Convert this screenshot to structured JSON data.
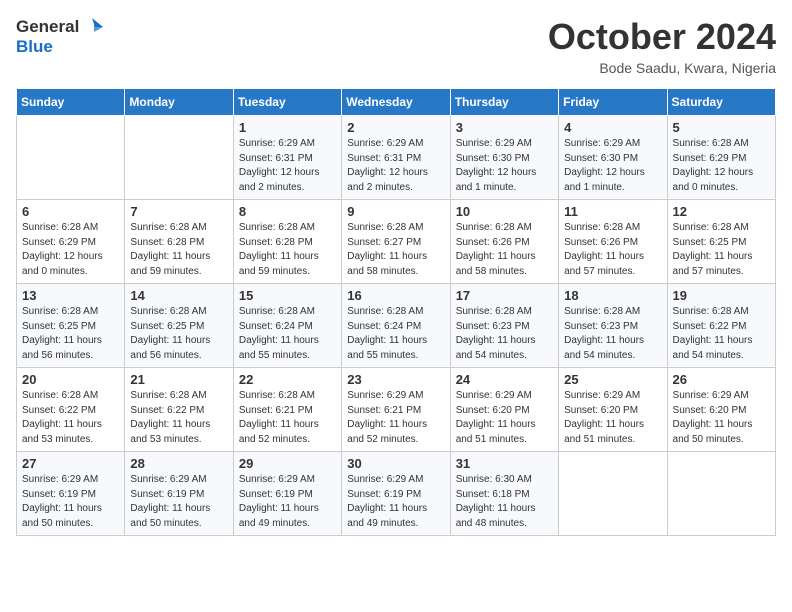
{
  "logo": {
    "general": "General",
    "blue": "Blue"
  },
  "title": "October 2024",
  "location": "Bode Saadu, Kwara, Nigeria",
  "weekdays": [
    "Sunday",
    "Monday",
    "Tuesday",
    "Wednesday",
    "Thursday",
    "Friday",
    "Saturday"
  ],
  "weeks": [
    [
      {
        "day": "",
        "info": ""
      },
      {
        "day": "",
        "info": ""
      },
      {
        "day": "1",
        "info": "Sunrise: 6:29 AM\nSunset: 6:31 PM\nDaylight: 12 hours and 2 minutes."
      },
      {
        "day": "2",
        "info": "Sunrise: 6:29 AM\nSunset: 6:31 PM\nDaylight: 12 hours and 2 minutes."
      },
      {
        "day": "3",
        "info": "Sunrise: 6:29 AM\nSunset: 6:30 PM\nDaylight: 12 hours and 1 minute."
      },
      {
        "day": "4",
        "info": "Sunrise: 6:29 AM\nSunset: 6:30 PM\nDaylight: 12 hours and 1 minute."
      },
      {
        "day": "5",
        "info": "Sunrise: 6:28 AM\nSunset: 6:29 PM\nDaylight: 12 hours and 0 minutes."
      }
    ],
    [
      {
        "day": "6",
        "info": "Sunrise: 6:28 AM\nSunset: 6:29 PM\nDaylight: 12 hours and 0 minutes."
      },
      {
        "day": "7",
        "info": "Sunrise: 6:28 AM\nSunset: 6:28 PM\nDaylight: 11 hours and 59 minutes."
      },
      {
        "day": "8",
        "info": "Sunrise: 6:28 AM\nSunset: 6:28 PM\nDaylight: 11 hours and 59 minutes."
      },
      {
        "day": "9",
        "info": "Sunrise: 6:28 AM\nSunset: 6:27 PM\nDaylight: 11 hours and 58 minutes."
      },
      {
        "day": "10",
        "info": "Sunrise: 6:28 AM\nSunset: 6:26 PM\nDaylight: 11 hours and 58 minutes."
      },
      {
        "day": "11",
        "info": "Sunrise: 6:28 AM\nSunset: 6:26 PM\nDaylight: 11 hours and 57 minutes."
      },
      {
        "day": "12",
        "info": "Sunrise: 6:28 AM\nSunset: 6:25 PM\nDaylight: 11 hours and 57 minutes."
      }
    ],
    [
      {
        "day": "13",
        "info": "Sunrise: 6:28 AM\nSunset: 6:25 PM\nDaylight: 11 hours and 56 minutes."
      },
      {
        "day": "14",
        "info": "Sunrise: 6:28 AM\nSunset: 6:25 PM\nDaylight: 11 hours and 56 minutes."
      },
      {
        "day": "15",
        "info": "Sunrise: 6:28 AM\nSunset: 6:24 PM\nDaylight: 11 hours and 55 minutes."
      },
      {
        "day": "16",
        "info": "Sunrise: 6:28 AM\nSunset: 6:24 PM\nDaylight: 11 hours and 55 minutes."
      },
      {
        "day": "17",
        "info": "Sunrise: 6:28 AM\nSunset: 6:23 PM\nDaylight: 11 hours and 54 minutes."
      },
      {
        "day": "18",
        "info": "Sunrise: 6:28 AM\nSunset: 6:23 PM\nDaylight: 11 hours and 54 minutes."
      },
      {
        "day": "19",
        "info": "Sunrise: 6:28 AM\nSunset: 6:22 PM\nDaylight: 11 hours and 54 minutes."
      }
    ],
    [
      {
        "day": "20",
        "info": "Sunrise: 6:28 AM\nSunset: 6:22 PM\nDaylight: 11 hours and 53 minutes."
      },
      {
        "day": "21",
        "info": "Sunrise: 6:28 AM\nSunset: 6:22 PM\nDaylight: 11 hours and 53 minutes."
      },
      {
        "day": "22",
        "info": "Sunrise: 6:28 AM\nSunset: 6:21 PM\nDaylight: 11 hours and 52 minutes."
      },
      {
        "day": "23",
        "info": "Sunrise: 6:29 AM\nSunset: 6:21 PM\nDaylight: 11 hours and 52 minutes."
      },
      {
        "day": "24",
        "info": "Sunrise: 6:29 AM\nSunset: 6:20 PM\nDaylight: 11 hours and 51 minutes."
      },
      {
        "day": "25",
        "info": "Sunrise: 6:29 AM\nSunset: 6:20 PM\nDaylight: 11 hours and 51 minutes."
      },
      {
        "day": "26",
        "info": "Sunrise: 6:29 AM\nSunset: 6:20 PM\nDaylight: 11 hours and 50 minutes."
      }
    ],
    [
      {
        "day": "27",
        "info": "Sunrise: 6:29 AM\nSunset: 6:19 PM\nDaylight: 11 hours and 50 minutes."
      },
      {
        "day": "28",
        "info": "Sunrise: 6:29 AM\nSunset: 6:19 PM\nDaylight: 11 hours and 50 minutes."
      },
      {
        "day": "29",
        "info": "Sunrise: 6:29 AM\nSunset: 6:19 PM\nDaylight: 11 hours and 49 minutes."
      },
      {
        "day": "30",
        "info": "Sunrise: 6:29 AM\nSunset: 6:19 PM\nDaylight: 11 hours and 49 minutes."
      },
      {
        "day": "31",
        "info": "Sunrise: 6:30 AM\nSunset: 6:18 PM\nDaylight: 11 hours and 48 minutes."
      },
      {
        "day": "",
        "info": ""
      },
      {
        "day": "",
        "info": ""
      }
    ]
  ]
}
